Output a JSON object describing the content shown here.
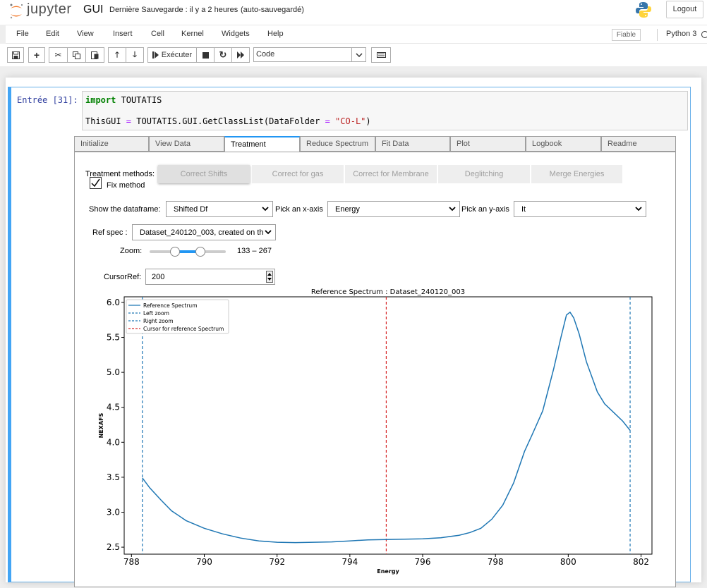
{
  "header": {
    "logo_text": "jupyter",
    "notebook_name": "GUI",
    "save_status": "Dernière Sauvegarde : il y a 2 heures",
    "autosave": "(auto-sauvegardé)",
    "logout": "Logout"
  },
  "menu": {
    "items": [
      "File",
      "Edit",
      "View",
      "Insert",
      "Cell",
      "Kernel",
      "Widgets",
      "Help"
    ],
    "trusted": "Fiable",
    "kernel": "Python 3"
  },
  "toolbar": {
    "run_label": "Exécuter",
    "cell_type": "Code"
  },
  "cell": {
    "prompt": "Entrée [31]:",
    "code_line1_kw": "import",
    "code_line1_rest": " TOUTATIS",
    "code_line2_a": "ThisGUI ",
    "code_line2_op1": "=",
    "code_line2_b": " TOUTATIS.GUI.GetClassList(DataFolder ",
    "code_line2_op2": "=",
    "code_line2_c": " ",
    "code_line2_str": "\"CO-L\"",
    "code_line2_d": ")"
  },
  "widget": {
    "tabs": [
      "Initialize",
      "View Data",
      "Treatment",
      "Reduce Spectrum",
      "Fit Data",
      "Plot",
      "Logbook",
      "Readme"
    ],
    "active_tab": "Treatment",
    "treatment_label": "Treatment methods:",
    "methods": [
      "Correct Shifts",
      "Correct for gas",
      "Correct for Membrane",
      "Deglitching",
      "Merge Energies"
    ],
    "fix_method_label": "Fix method",
    "fix_method_checked": true,
    "show_df_label": "Show the dataframe:",
    "show_df_value": "Shifted Df",
    "x_axis_label": "Pick an x-axis",
    "x_axis_value": "Energy",
    "y_axis_label": "Pick an y-axis",
    "y_axis_value": "It",
    "ref_spec_label": "Ref spec :",
    "ref_spec_value": "Dataset_240120_003, created on th",
    "zoom_label": "Zoom:",
    "zoom_value": "133 – 267",
    "zoom_range": [
      133,
      267
    ],
    "zoom_max": 400,
    "cursor_label": "CursorRef:",
    "cursor_value": "200"
  },
  "chart_data": {
    "type": "line",
    "title": "Reference Spectrum : Dataset_240120_003",
    "xlabel": "Energy",
    "ylabel": "NEXAFS",
    "xlim": [
      787.8,
      802.3
    ],
    "ylim": [
      2.4,
      6.08
    ],
    "xticks": [
      788,
      790,
      792,
      794,
      796,
      798,
      800,
      802
    ],
    "yticks": [
      2.5,
      3.0,
      3.5,
      4.0,
      4.5,
      5.0,
      5.5,
      6.0
    ],
    "ytick_labels": [
      "2.5",
      "3.0",
      "3.5",
      "4.0",
      "4.5",
      "5.0",
      "5.5",
      "6.0"
    ],
    "legend_position": "top-left",
    "series": [
      {
        "name": "Reference Spectrum",
        "color": "#1f77b4",
        "style": "solid",
        "x": [
          788.3,
          788.5,
          788.8,
          789.1,
          789.5,
          790.0,
          790.5,
          791.0,
          791.5,
          792.0,
          792.5,
          793.0,
          793.5,
          794.0,
          794.5,
          795.0,
          795.5,
          796.0,
          796.5,
          797.0,
          797.3,
          797.6,
          797.9,
          798.2,
          798.5,
          798.8,
          799.0,
          799.3,
          799.6,
          799.8,
          799.95,
          800.05,
          800.15,
          800.3,
          800.5,
          800.8,
          801.0,
          801.3,
          801.5,
          801.7
        ],
        "y": [
          3.49,
          3.35,
          3.18,
          3.02,
          2.88,
          2.77,
          2.69,
          2.63,
          2.59,
          2.57,
          2.565,
          2.57,
          2.575,
          2.59,
          2.605,
          2.61,
          2.615,
          2.62,
          2.635,
          2.67,
          2.71,
          2.77,
          2.9,
          3.1,
          3.42,
          3.87,
          4.1,
          4.45,
          5.05,
          5.5,
          5.82,
          5.86,
          5.78,
          5.55,
          5.15,
          4.72,
          4.55,
          4.4,
          4.3,
          4.17
        ]
      },
      {
        "name": "Left zoom",
        "color": "#1f77b4",
        "style": "dashed",
        "x_value": 788.3
      },
      {
        "name": "Right zoom",
        "color": "#1f77b4",
        "style": "dashed",
        "x_value": 801.7
      },
      {
        "name": "Cursor for reference Spectrum",
        "color": "#d62728",
        "style": "dashed",
        "x_value": 795.0
      }
    ]
  }
}
